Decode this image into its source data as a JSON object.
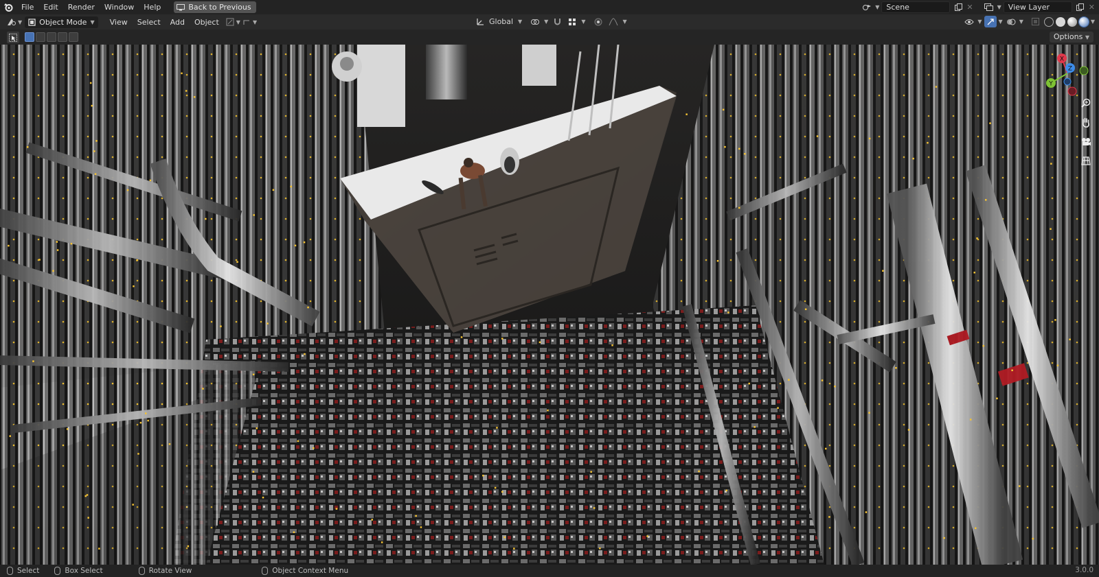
{
  "app": {
    "menu": [
      "File",
      "Edit",
      "Render",
      "Window",
      "Help"
    ],
    "back_button": "Back to Previous",
    "scene_name": "Scene",
    "view_layer": "View Layer"
  },
  "header": {
    "mode": "Object Mode",
    "menus": [
      "View",
      "Select",
      "Add",
      "Object"
    ],
    "transform_orientation": "Global"
  },
  "tool_settings": {
    "options_label": "Options"
  },
  "viewport": {
    "gizmo_axes": [
      "X",
      "Y",
      "Z"
    ]
  },
  "statusbar": {
    "select": "Select",
    "box_select": "Box Select",
    "rotate_view": "Rotate View",
    "context_menu": "Object Context Menu",
    "version": "3.0.0"
  },
  "icons": {
    "logo": "blender-logo-icon",
    "back": "monitor-icon",
    "scene": "scene-icon",
    "view_layer": "view-layer-icon"
  },
  "colors": {
    "accent": "#4772b3",
    "axis_x": "#e0384b",
    "axis_y": "#7ec234",
    "axis_z": "#3d8ce8"
  }
}
